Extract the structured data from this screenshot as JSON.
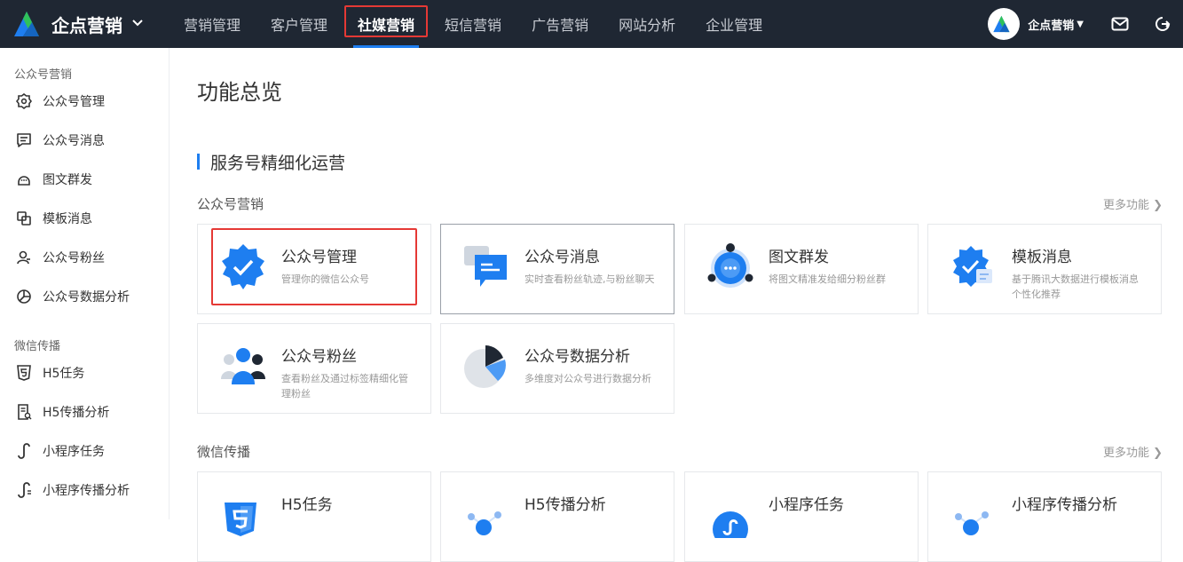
{
  "brand": {
    "name": "企点营销"
  },
  "nav": [
    {
      "label": "营销管理",
      "active": false
    },
    {
      "label": "客户管理",
      "active": false
    },
    {
      "label": "社媒营销",
      "active": true
    },
    {
      "label": "短信营销",
      "active": false
    },
    {
      "label": "广告营销",
      "active": false
    },
    {
      "label": "网站分析",
      "active": false
    },
    {
      "label": "企业管理",
      "active": false
    }
  ],
  "user": {
    "name": "企点营销"
  },
  "colors": {
    "topbar": "#1f2733",
    "accent": "#1e7ef0",
    "highlight": "#e53935"
  },
  "sidebar": {
    "groups": [
      {
        "label": "公众号营销",
        "items": [
          {
            "label": "公众号管理",
            "icon": "gear-badge-icon"
          },
          {
            "label": "公众号消息",
            "icon": "message-icon"
          },
          {
            "label": "图文群发",
            "icon": "broadcast-icon"
          },
          {
            "label": "模板消息",
            "icon": "template-icon"
          },
          {
            "label": "公众号粉丝",
            "icon": "user-icon"
          },
          {
            "label": "公众号数据分析",
            "icon": "pie-chart-icon"
          }
        ]
      },
      {
        "label": "微信传播",
        "items": [
          {
            "label": "H5任务",
            "icon": "html5-icon"
          },
          {
            "label": "H5传播分析",
            "icon": "report-icon"
          },
          {
            "label": "小程序任务",
            "icon": "miniprogram-icon"
          },
          {
            "label": "小程序传播分析",
            "icon": "miniprogram-analysis-icon"
          }
        ]
      }
    ]
  },
  "main": {
    "title": "功能总览",
    "section": "服务号精细化运营",
    "more_label": "更多功能 ❯",
    "groups": [
      {
        "label": "公众号营销",
        "cards": [
          {
            "title": "公众号管理",
            "desc": "管理你的微信公众号",
            "icon": "verified-badge-icon"
          },
          {
            "title": "公众号消息",
            "desc": "实时查看粉丝轨迹,与粉丝聊天",
            "icon": "chat-bubble-icon"
          },
          {
            "title": "图文群发",
            "desc": "将图文精准发给细分粉丝群",
            "icon": "broadcast-icon"
          },
          {
            "title": "模板消息",
            "desc": "基于腾讯大数据进行模板消息个性化推荐",
            "icon": "template-badge-icon"
          },
          {
            "title": "公众号粉丝",
            "desc": "查看粉丝及通过标签精细化管理粉丝",
            "icon": "users-icon"
          },
          {
            "title": "公众号数据分析",
            "desc": "多维度对公众号进行数据分析",
            "icon": "pie-chart-icon"
          }
        ]
      },
      {
        "label": "微信传播",
        "cards": [
          {
            "title": "H5任务",
            "desc": "",
            "icon": "html5-icon"
          },
          {
            "title": "H5传播分析",
            "desc": "",
            "icon": "share-network-icon"
          },
          {
            "title": "小程序任务",
            "desc": "",
            "icon": "miniprogram-icon"
          },
          {
            "title": "小程序传播分析",
            "desc": "",
            "icon": "miniprogram-share-icon"
          }
        ]
      }
    ]
  }
}
